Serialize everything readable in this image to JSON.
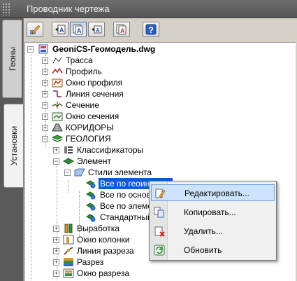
{
  "window": {
    "title": "Проводник чертежа"
  },
  "sidetabs": [
    {
      "label": "Геоны",
      "active": false
    },
    {
      "label": "Установки",
      "active": true
    }
  ],
  "toolbar": {
    "buttons": [
      {
        "icon": "pencil-edit-icon",
        "pressed": false
      },
      {
        "icon": "text-arrow-left-icon",
        "pressed": false
      },
      {
        "icon": "text-layers-icon",
        "pressed": true
      },
      {
        "icon": "text-arrow-small-icon",
        "pressed": false
      },
      {
        "icon": "text-layers-alt-icon",
        "pressed": false
      },
      {
        "icon": "help-icon",
        "pressed": false
      }
    ]
  },
  "tree": {
    "root": "GeoniCS-Геомодель.dwg",
    "items": {
      "trassa": "Трасса",
      "profil": "Профиль",
      "okno_profilya": "Окно профиля",
      "liniya_secheniya": "Линия сечения",
      "sechenie": "Сечение",
      "okno_secheniya": "Окно сечения",
      "koridory": "КОРИДОРЫ",
      "geologiya": "ГЕОЛОГИЯ",
      "klassifikatory": "Классификаторы",
      "element": "Элемент",
      "stili_elementa": "Стили элемента",
      "style_1": "Все по геоиндексу",
      "style_2": "Все по основе",
      "style_3": "Все по элементу",
      "style_4": "Стандартный",
      "vyrabotka": "Выработка",
      "okno_kolonki": "Окно колонки",
      "liniya_razreza": "Линия разреза",
      "razrez": "Разрез",
      "okno_razreza": "Окно разреза"
    }
  },
  "context_menu": {
    "items": {
      "edit": "Редактировать...",
      "copy": "Копировать...",
      "delete": "Удалить...",
      "refresh": "Обновить"
    },
    "highlighted": "edit"
  },
  "colors": {
    "selection": "#0a5bd6",
    "menu_highlight": "#cde3fb",
    "panel": "#d4d0c8"
  }
}
